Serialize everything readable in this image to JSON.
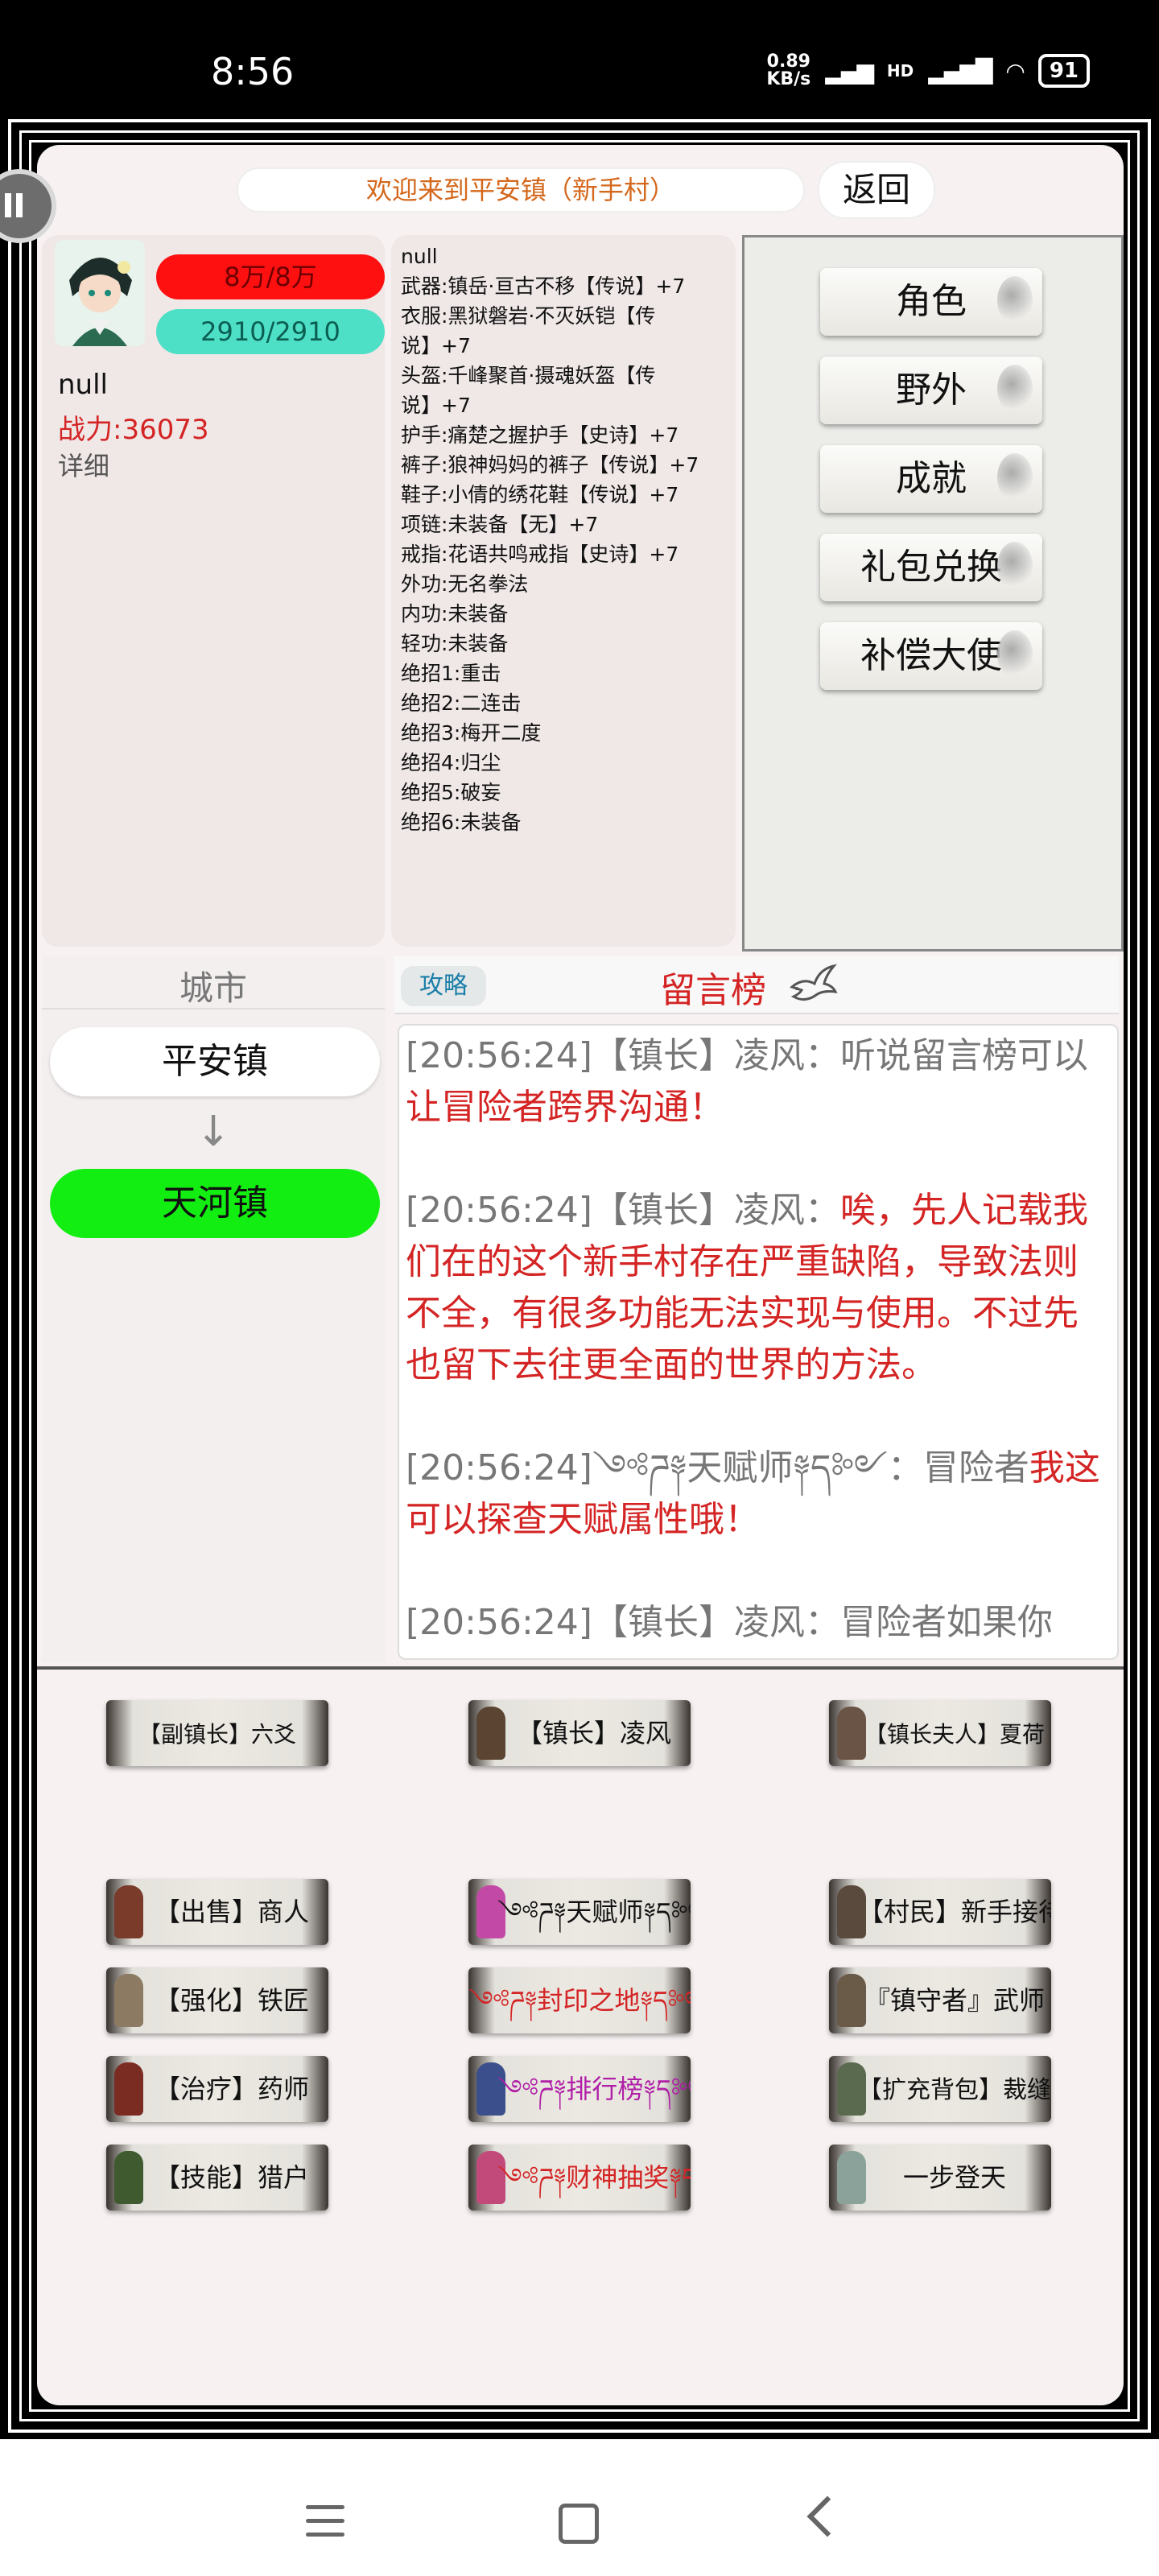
{
  "status_bar": {
    "time": "8:56",
    "net_speed_value": "0.89",
    "net_speed_unit": "KB/s",
    "signal_text": "HD",
    "battery": "91"
  },
  "header": {
    "welcome": "欢迎来到平安镇（新手村）",
    "back_label": "返回"
  },
  "player": {
    "hp": "8万/8万",
    "mp": "2910/2910",
    "name": "null",
    "power": "战力:36073",
    "detail_label": "详细"
  },
  "equipment": [
    "null",
    "武器:镇岳·亘古不移【传说】+7",
    "衣服:黑狱磐岩·不灭妖铠【传",
    "说】+7",
    "头盔:千峰聚首·摄魂妖盔【传",
    "说】+7",
    "护手:痛楚之握护手【史诗】+7",
    "裤子:狼神妈妈的裤子【传说】+7",
    "鞋子:小倩的绣花鞋【传说】+7",
    "项链:未装备【无】+7",
    "戒指:花语共鸣戒指【史诗】+7",
    "外功:无名拳法",
    "内功:未装备",
    "轻功:未装备",
    "绝招1:重击",
    "绝招2:二连击",
    "绝招3:梅开二度",
    "绝招4:归尘",
    "绝招5:破妄",
    "绝招6:未装备"
  ],
  "menu": {
    "items": [
      "角色",
      "野外",
      "成就",
      "礼包兑换",
      "补偿大使"
    ]
  },
  "city": {
    "title": "城市",
    "current": "平安镇",
    "arrow": "↓",
    "next": "天河镇"
  },
  "guestbook": {
    "strategy_label": "攻略",
    "title": "留言榜",
    "messages": [
      {
        "prefix": "[20:56:24]【镇长】凌风：听说留言榜可以",
        "text": "让冒险者跨界沟通！"
      },
      {
        "prefix": "[20:56:24]【镇长】凌风：",
        "text": "唉，先人记载我们在的这个新手村存在严重缺陷，导致法则不全，有很多功能无法实现与使用。不过先也留下去往更全面的世界的方法。"
      },
      {
        "prefix": "[20:56:24]༺ཌ༈天赋师༈ད༻：冒险者",
        "text": "我这可以探查天赋属性哦！"
      },
      {
        "prefix": "[20:56:24]【镇长】凌风：冒险者如果你",
        "text": ""
      }
    ]
  },
  "npcs": {
    "row1": [
      "【副镇长】六爻",
      "【镇长】凌风",
      "【镇长夫人】夏荷"
    ],
    "row2": [
      "【出售】商人",
      "༺ཌ༈天赋师༈ད༻",
      "【村民】新手接待"
    ],
    "row3": [
      "【强化】铁匠",
      "༺ཌ༈封印之地༈ད༻",
      "『镇守者』武师"
    ],
    "row4": [
      "【治疗】药师",
      "༺ཌ༈排行榜༈ད༻",
      "【扩充背包】裁缝"
    ],
    "row5": [
      "【技能】猎户",
      "༺ཌ༈财神抽奖༈ད༻",
      "一步登天"
    ]
  },
  "colors": {
    "hp": "#ff1010",
    "mp": "#4de0c6",
    "next_city": "#12ee12",
    "accent_red": "#d42424",
    "welcome_text": "#d4681c",
    "purple_npc": "#b01fa6",
    "red_npc": "#d42424"
  }
}
